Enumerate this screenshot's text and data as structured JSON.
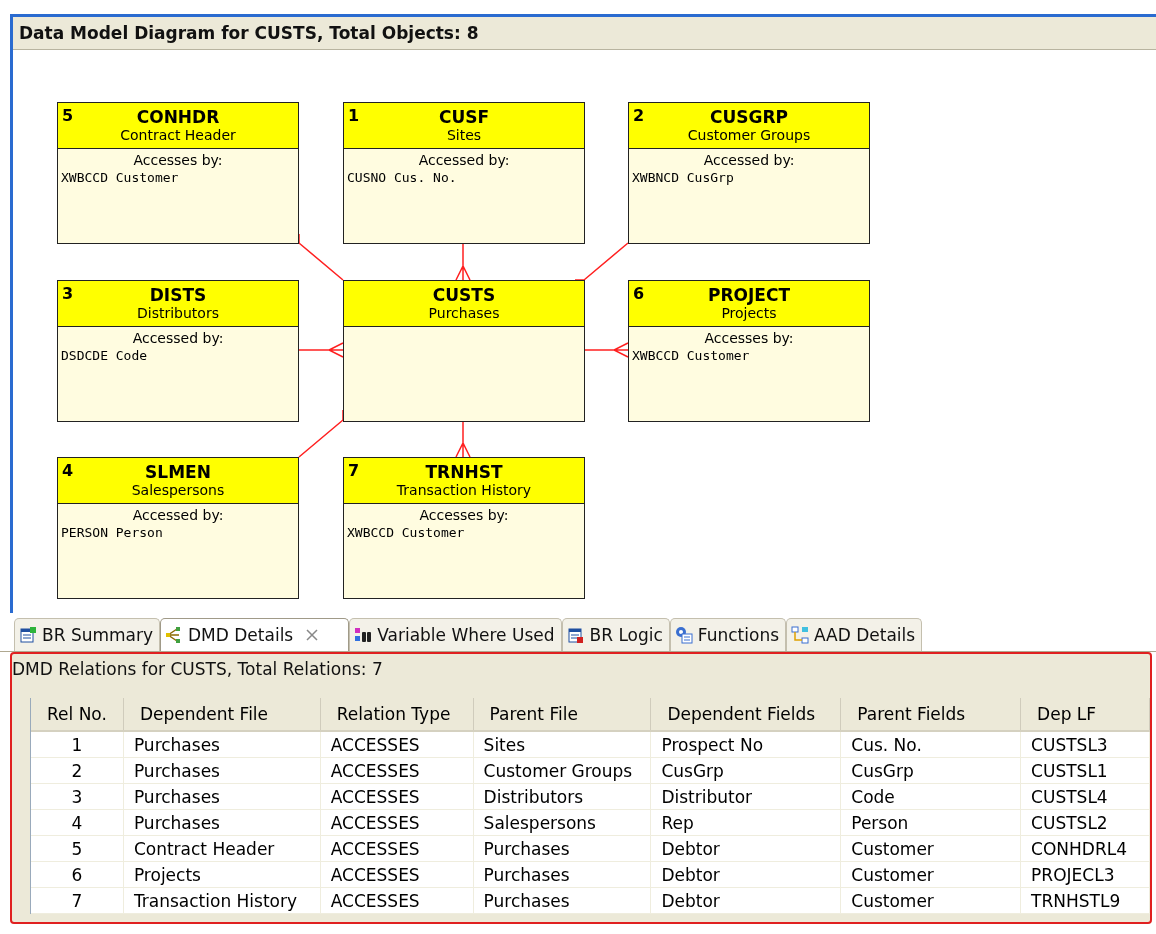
{
  "diagram": {
    "title": "Data Model Diagram for CUSTS, Total Objects: 8",
    "entities": [
      {
        "number": "5",
        "name": "CONHDR",
        "description": "Contract Header",
        "access_label": "Accesses by:",
        "access_key": "XWBCCD",
        "access_field": "Customer"
      },
      {
        "number": "1",
        "name": "CUSF",
        "description": "Sites",
        "access_label": "Accessed by:",
        "access_key": "CUSNO",
        "access_field": "Cus. No."
      },
      {
        "number": "2",
        "name": "CUSGRP",
        "description": "Customer Groups",
        "access_label": "Accessed by:",
        "access_key": "XWBNCD",
        "access_field": "CusGrp"
      },
      {
        "number": "3",
        "name": "DISTS",
        "description": "Distributors",
        "access_label": "Accessed by:",
        "access_key": "DSDCDE",
        "access_field": "Code"
      },
      {
        "name": "CUSTS",
        "description": "Purchases"
      },
      {
        "number": "6",
        "name": "PROJECT",
        "description": "Projects",
        "access_label": "Accesses by:",
        "access_key": "XWBCCD",
        "access_field": "Customer"
      },
      {
        "number": "4",
        "name": "SLMEN",
        "description": "Salespersons",
        "access_label": "Accessed by:",
        "access_key": "PERSON",
        "access_field": "Person"
      },
      {
        "number": "7",
        "name": "TRNHST",
        "description": "Transaction History",
        "access_label": "Accesses by:",
        "access_key": "XWBCCD",
        "access_field": "Customer"
      }
    ]
  },
  "tabs": [
    {
      "label": "BR Summary",
      "selected": false,
      "kind": "summary"
    },
    {
      "label": "DMD Details",
      "selected": true,
      "kind": "dmd"
    },
    {
      "label": "Variable Where Used",
      "selected": false,
      "kind": "search"
    },
    {
      "label": "BR Logic",
      "selected": false,
      "kind": "logic"
    },
    {
      "label": "Functions",
      "selected": false,
      "kind": "functions"
    },
    {
      "label": "AAD Details",
      "selected": false,
      "kind": "aad"
    }
  ],
  "relations": {
    "title": "DMD Relations for CUSTS, Total Relations: 7",
    "columns": [
      "Rel No.",
      "Dependent File",
      "Relation Type",
      "Parent File",
      "Dependent Fields",
      "Parent Fields",
      "Dep LF"
    ],
    "rows": [
      [
        "1",
        "Purchases",
        "ACCESSES",
        "Sites",
        "Prospect No",
        "Cus. No.",
        "CUSTSL3"
      ],
      [
        "2",
        "Purchases",
        "ACCESSES",
        "Customer Groups",
        "CusGrp",
        "CusGrp",
        "CUSTSL1"
      ],
      [
        "3",
        "Purchases",
        "ACCESSES",
        "Distributors",
        "Distributor",
        "Code",
        "CUSTSL4"
      ],
      [
        "4",
        "Purchases",
        "ACCESSES",
        "Salespersons",
        "Rep",
        "Person",
        "CUSTSL2"
      ],
      [
        "5",
        "Contract Header",
        "ACCESSES",
        "Purchases",
        "Debtor",
        "Customer",
        "CONHDRL4"
      ],
      [
        "6",
        "Projects",
        "ACCESSES",
        "Purchases",
        "Debtor",
        "Customer",
        "PROJECL3"
      ],
      [
        "7",
        "Transaction History",
        "ACCESSES",
        "Purchases",
        "Debtor",
        "Customer",
        "TRNHSTL9"
      ]
    ]
  }
}
